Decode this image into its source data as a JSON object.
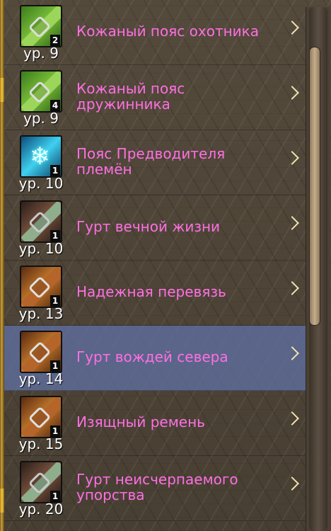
{
  "items": [
    {
      "name": "Кожаный пояс охотника",
      "level": "ур. 9",
      "qty": "2",
      "style": "green",
      "selected": false
    },
    {
      "name": "Кожаный пояс дружинника",
      "level": "ур. 9",
      "qty": "4",
      "style": "green",
      "selected": false
    },
    {
      "name": "Пояс Предводителя племён",
      "level": "ур. 10",
      "qty": "1",
      "style": "ice",
      "selected": false
    },
    {
      "name": "Гурт вечной жизни",
      "level": "ур. 10",
      "qty": "1",
      "style": "dark",
      "selected": false
    },
    {
      "name": "Надежная перевязь",
      "level": "ур. 13",
      "qty": "1",
      "style": "brown",
      "selected": false
    },
    {
      "name": "Гурт вождей севера",
      "level": "ур. 14",
      "qty": "1",
      "style": "brown",
      "selected": true
    },
    {
      "name": "Изящный ремень",
      "level": "ур. 15",
      "qty": "1",
      "style": "brown",
      "selected": false
    },
    {
      "name": "Гурт неисчерпаемого упорства",
      "level": "ур. 20",
      "qty": "1",
      "style": "dark",
      "selected": false
    }
  ],
  "colors": {
    "item_name": "#ff6fe2",
    "selected_row": "#5f70a0",
    "level_text": "#ffffff"
  }
}
